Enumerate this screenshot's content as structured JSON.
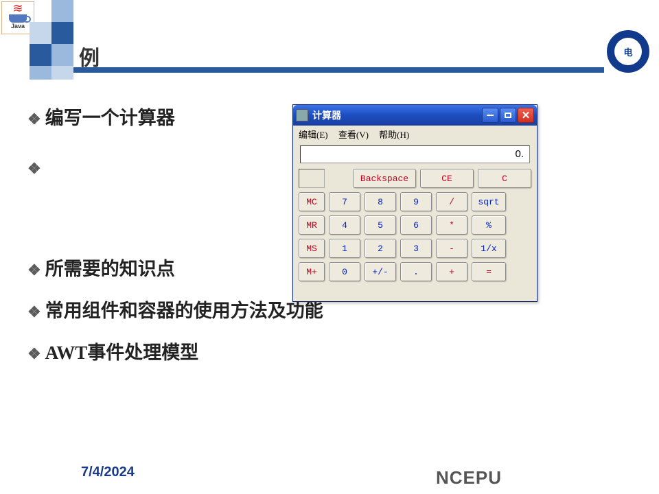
{
  "logo": {
    "name": "Java"
  },
  "slide": {
    "title": "例",
    "bullets": [
      "编写一个计算器",
      "",
      "所需要的知识点",
      "常用组件和容器的使用方法及功能",
      "AWT事件处理模型"
    ],
    "date": "7/4/2024",
    "org": "NCEPU"
  },
  "calc": {
    "window_title": "计算器",
    "menu": {
      "edit": "编辑(E)",
      "view": "查看(V)",
      "help": "帮助(H)"
    },
    "display": "0.",
    "clear": {
      "backspace": "Backspace",
      "ce": "CE",
      "c": "C"
    },
    "memory": [
      "MC",
      "MR",
      "MS",
      "M+"
    ],
    "rows": [
      [
        "7",
        "8",
        "9",
        "/",
        "sqrt"
      ],
      [
        "4",
        "5",
        "6",
        "*",
        "%"
      ],
      [
        "1",
        "2",
        "3",
        "-",
        "1/x"
      ],
      [
        "0",
        "+/-",
        ".",
        "+",
        "="
      ]
    ]
  }
}
